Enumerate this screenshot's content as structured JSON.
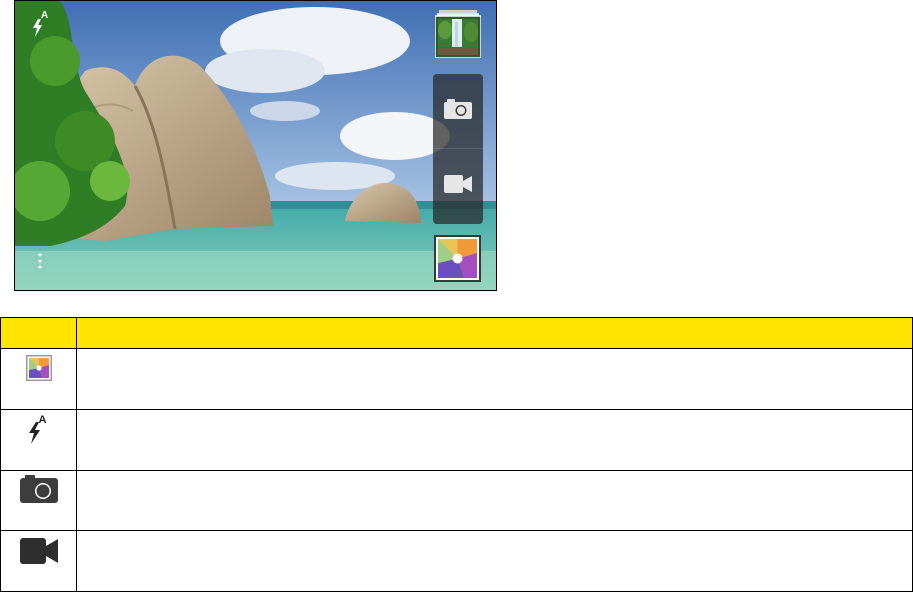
{
  "camera_screen": {
    "flash_indicator": {
      "icon": "flash-auto-icon",
      "label": "A"
    },
    "gallery_thumbnail": {
      "icon": "gallery-thumbnail-icon"
    },
    "mode_switch": [
      {
        "icon": "camera-icon"
      },
      {
        "icon": "video-camera-icon"
      }
    ],
    "effects_button": {
      "icon": "effects-icon"
    },
    "menu_button": {
      "icon": "menu-dots-icon"
    }
  },
  "icon_table": {
    "headers": [
      "",
      ""
    ],
    "rows": [
      {
        "icon": "effects-icon",
        "description": ""
      },
      {
        "icon": "flash-auto-icon",
        "icon_label": "A",
        "description": ""
      },
      {
        "icon": "camera-icon",
        "description": ""
      },
      {
        "icon": "video-camera-icon",
        "description": ""
      }
    ]
  },
  "colors": {
    "header_fill": "#ffe500",
    "border": "#000000",
    "panel": "#2e2e2e"
  }
}
